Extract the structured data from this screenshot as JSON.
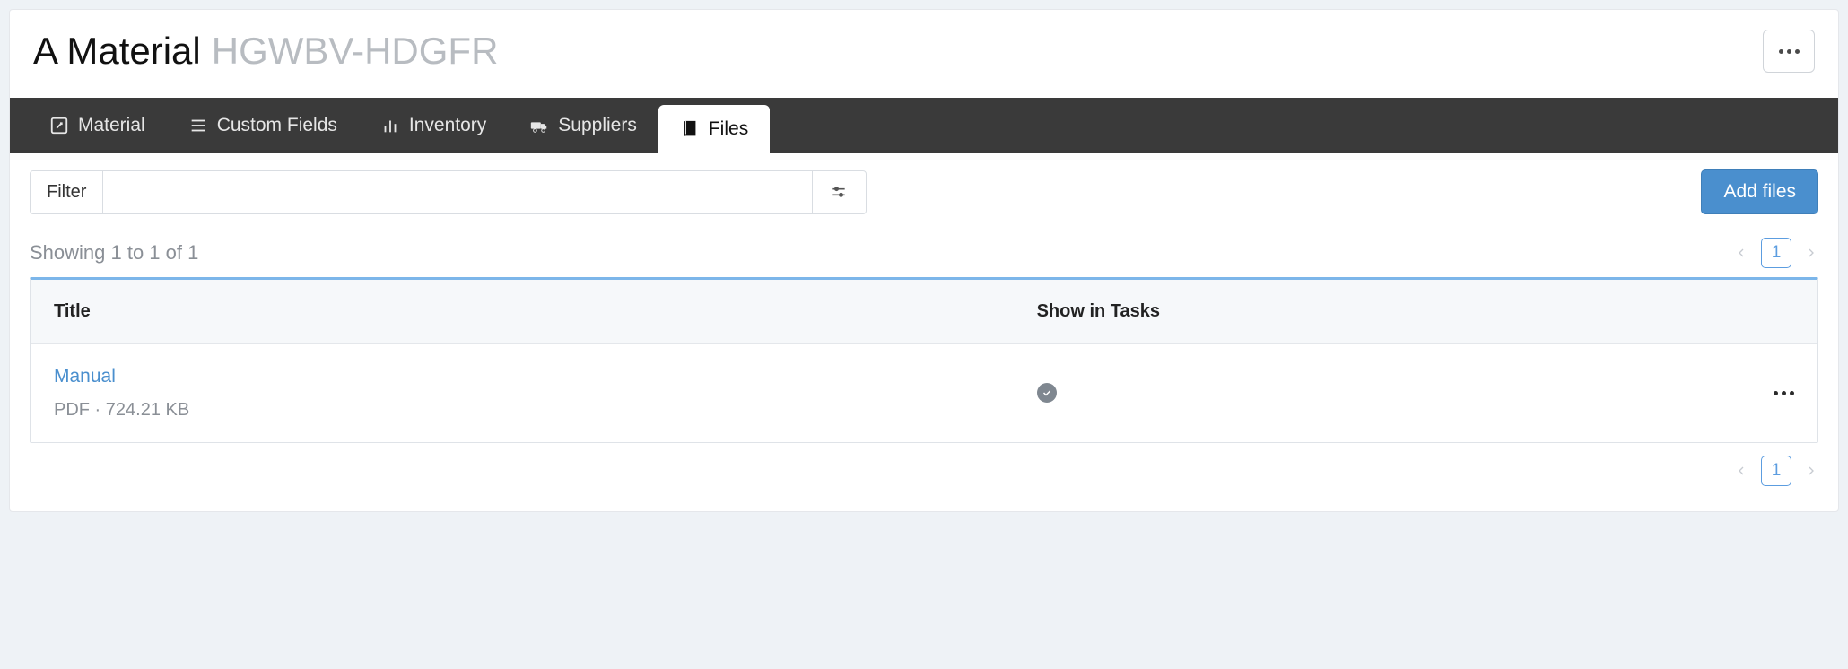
{
  "header": {
    "title": "A Material",
    "code": "HGWBV-HDGFR"
  },
  "tabs": {
    "material": "Material",
    "custom_fields": "Custom Fields",
    "inventory": "Inventory",
    "suppliers": "Suppliers",
    "files": "Files"
  },
  "toolbar": {
    "filter_label": "Filter",
    "filter_value": "",
    "add_label": "Add files"
  },
  "list": {
    "showing_text": "Showing 1 to 1 of 1",
    "page_current": "1",
    "columns": {
      "title": "Title",
      "show_in_tasks": "Show in Tasks"
    },
    "rows": [
      {
        "title": "Manual",
        "meta": "PDF  ·  724.21 KB",
        "show_in_tasks": true
      }
    ]
  }
}
